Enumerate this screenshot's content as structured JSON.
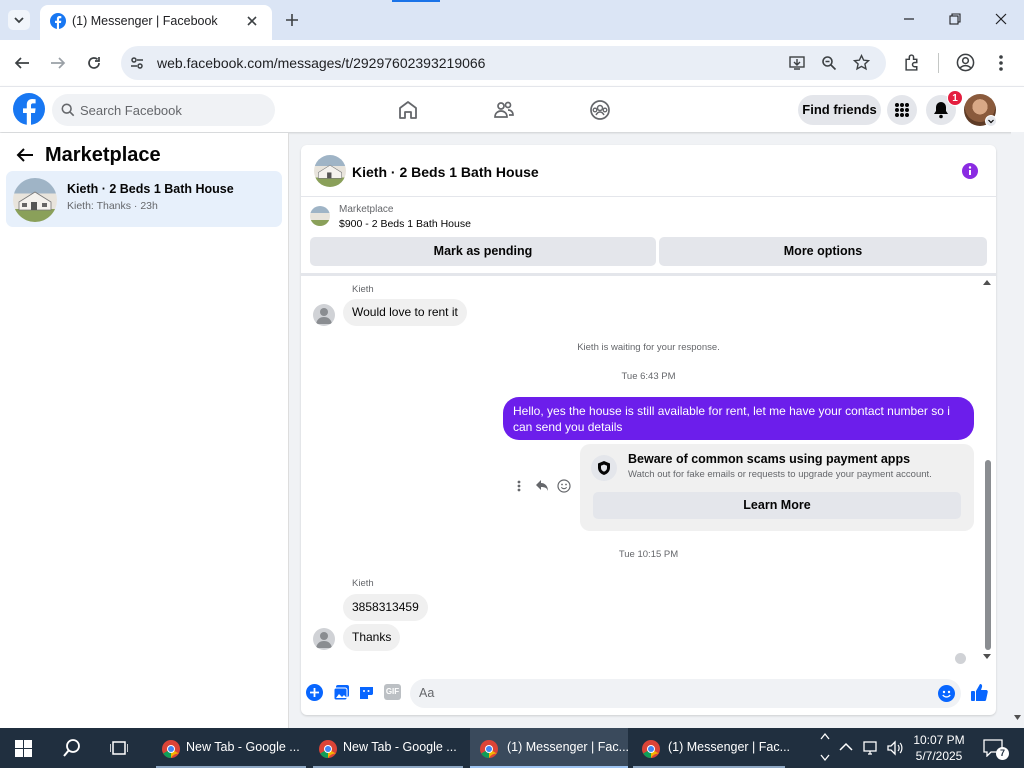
{
  "browser": {
    "tab_title": "(1) Messenger | Facebook",
    "url": "web.facebook.com/messages/t/29297602393219066"
  },
  "fb_header": {
    "search_placeholder": "Search Facebook",
    "find_friends": "Find friends",
    "notification_count": "1"
  },
  "sidebar": {
    "title": "Marketplace",
    "conversation": {
      "name": "Kieth · 2 Beds 1 Bath House",
      "preview": "Kieth: Thanks · 23h"
    }
  },
  "chat": {
    "title": "Kieth · 2 Beds 1 Bath House",
    "marketplace_label": "Marketplace",
    "listing": "$900 - 2 Beds 1 Bath House",
    "mark_pending": "Mark as pending",
    "more_options": "More options",
    "sender_name": "Kieth",
    "msg_rent": "Would love to rent it",
    "waiting": "Kieth is waiting for your response.",
    "time1": "Tue 6:43 PM",
    "outgoing": "Hello, yes the house is still available for rent, let me have your contact number so i can send you  details",
    "scam_title": "Beware of common scams using payment apps",
    "scam_sub": "Watch out for fake emails or requests to upgrade your payment account.",
    "learn_more": "Learn More",
    "time2": "Tue 10:15 PM",
    "msg_number": "3858313459",
    "msg_thanks": "Thanks",
    "composer_placeholder": "Aa",
    "accent": "#6c1eeb"
  },
  "taskbar": {
    "apps": [
      {
        "label": "New Tab - Google ..."
      },
      {
        "label": "New Tab - Google ..."
      },
      {
        "label": "(1) Messenger | Fac..."
      },
      {
        "label": "(1) Messenger | Fac..."
      }
    ],
    "time": "10:07 PM",
    "date": "5/7/2025",
    "notif_count": "7"
  }
}
